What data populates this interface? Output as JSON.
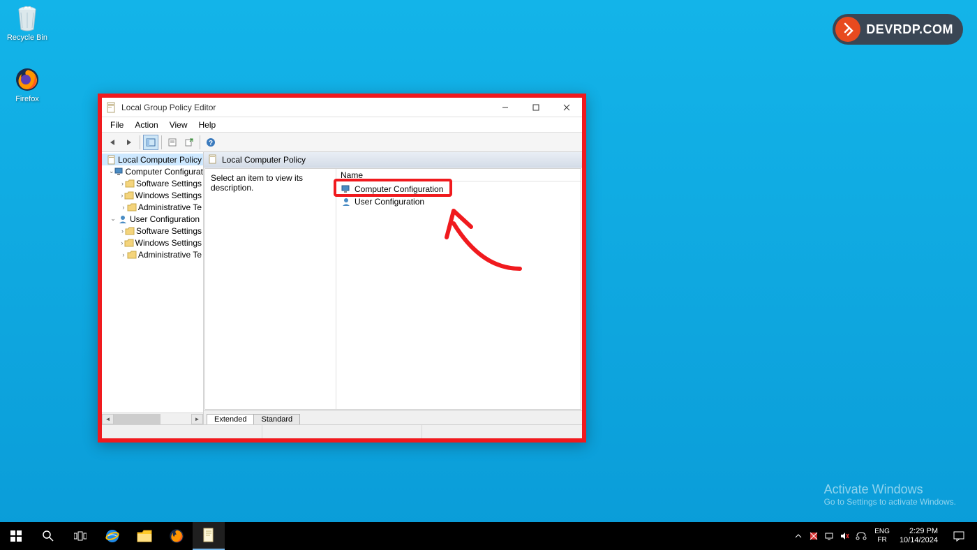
{
  "desktop": {
    "icons": [
      {
        "name": "recycle-bin",
        "label": "Recycle Bin"
      },
      {
        "name": "firefox",
        "label": "Firefox"
      }
    ]
  },
  "watermark": {
    "title": "Activate Windows",
    "subtitle": "Go to Settings to activate Windows."
  },
  "logo": {
    "text": "DEVRDP.COM"
  },
  "window": {
    "title": "Local Group Policy Editor",
    "menu": [
      "File",
      "Action",
      "View",
      "Help"
    ],
    "header_title": "Local Computer Policy",
    "description_hint": "Select an item to view its description.",
    "list_header": "Name",
    "list_items": [
      "Computer Configuration",
      "User Configuration"
    ],
    "tabs": [
      "Extended",
      "Standard"
    ],
    "tree": {
      "root": "Local Computer Policy",
      "nodes": [
        {
          "label": "Computer Configurat",
          "children": [
            "Software Settings",
            "Windows Settings",
            "Administrative Te"
          ]
        },
        {
          "label": "User Configuration",
          "children": [
            "Software Settings",
            "Windows Settings",
            "Administrative Te"
          ]
        }
      ]
    }
  },
  "taskbar": {
    "lang1": "ENG",
    "lang2": "FR",
    "time": "2:29 PM",
    "date": "10/14/2024"
  }
}
